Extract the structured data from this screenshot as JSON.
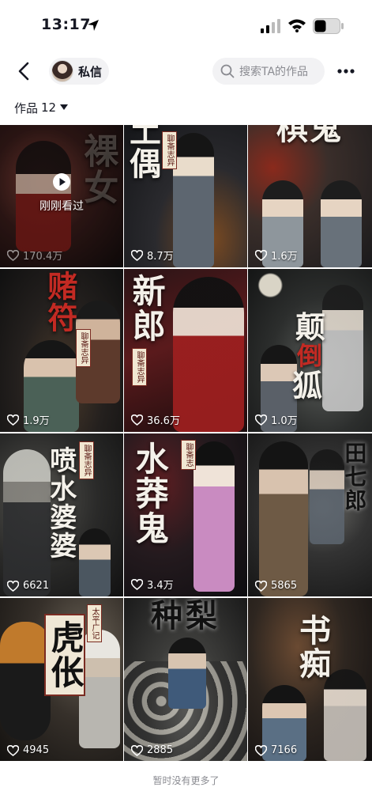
{
  "status_bar": {
    "time": "13:17"
  },
  "nav": {
    "dm_label": "私信",
    "search_placeholder": "搜索TA的作品"
  },
  "works": {
    "label": "作品",
    "count": "12"
  },
  "just_watched_label": "刚刚看过",
  "tiles": [
    {
      "title": "裸女",
      "likes": "170.4万"
    },
    {
      "title": "土偶",
      "seal": "聊斋志异",
      "likes": "8.7万"
    },
    {
      "title": "棋鬼",
      "likes": "1.6万"
    },
    {
      "title": "赌符",
      "seal": "聊斋志异",
      "likes": "1.9万"
    },
    {
      "title": "新郎",
      "seal": "聊斋志异",
      "likes": "36.6万"
    },
    {
      "title_a": "颠",
      "title_b": "倒",
      "title_c": "狐",
      "likes": "1.0万"
    },
    {
      "title": "喷水婆婆",
      "seal": "聊斋志异",
      "likes": "6621"
    },
    {
      "title": "水莽鬼",
      "seal": "聊斋志",
      "likes": "3.4万"
    },
    {
      "title": "田七郎",
      "likes": "5865"
    },
    {
      "title": "虎伥",
      "seal": "太平广记",
      "likes": "4945"
    },
    {
      "title": "种梨",
      "likes": "2885"
    },
    {
      "title": "书痴",
      "likes": "7166"
    }
  ],
  "footer": "暂时没有更多了",
  "colors": {
    "accent_red": "#c22a23",
    "text": "#161823",
    "muted": "#8a8b91",
    "pill_bg": "#f2f2f4"
  }
}
